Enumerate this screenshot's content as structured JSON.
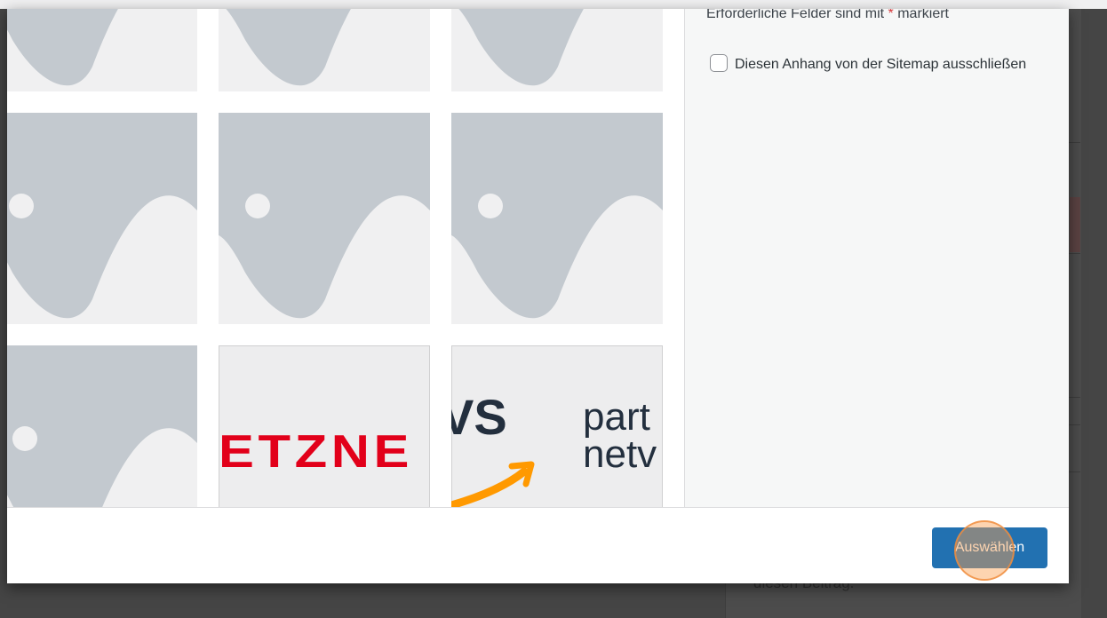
{
  "details": {
    "required_note": "Erforderliche Felder sind mit",
    "required_star": "*",
    "required_suffix": "markiert",
    "sitemap_exclude_label": "Diesen Anhang von der Sitemap ausschließen"
  },
  "attachments": {
    "logo_hetzner_text": "ETZNE",
    "logo_aws_text": "VS",
    "logo_partner_line1": "part",
    "logo_partner_line2": "netv"
  },
  "toolbar": {
    "select_label": "Auswählen"
  },
  "background": {
    "text": "diesen Beitrag."
  },
  "colors": {
    "primary_button": "#2271b1",
    "required_star": "#d63638",
    "hetzner_red": "#e2001a",
    "aws_orange": "#ff9900"
  }
}
